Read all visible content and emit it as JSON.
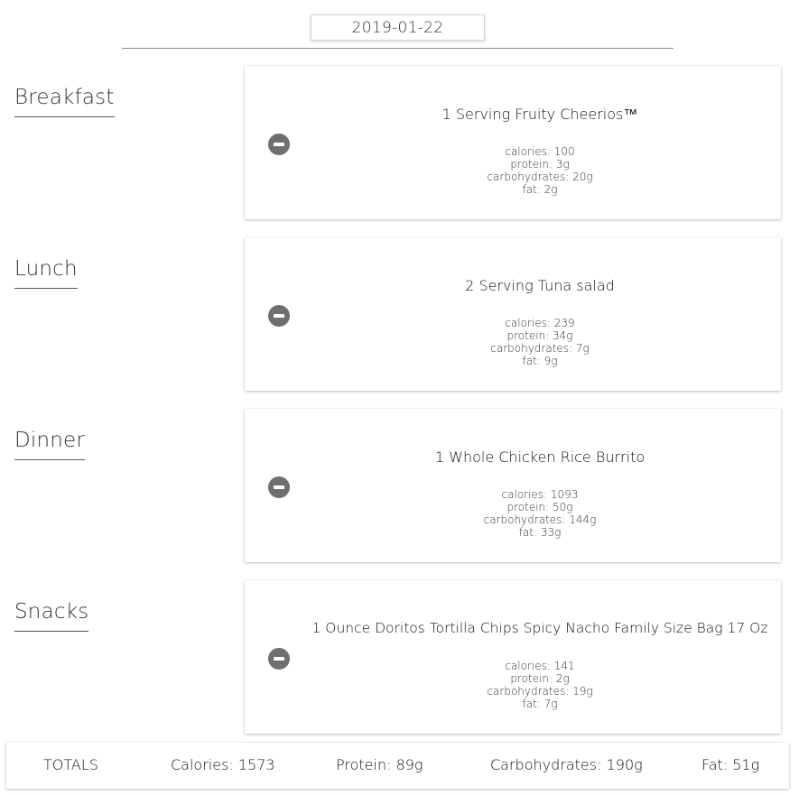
{
  "date": "2019-01-22",
  "meals": [
    {
      "label": "Breakfast",
      "food": "1 Serving Fruity Cheerios™",
      "nutrients": [
        "calories: 100",
        "protein: 3g",
        "carbohydrates: 20g",
        "fat: 2g"
      ]
    },
    {
      "label": "Lunch",
      "food": "2 Serving Tuna salad",
      "nutrients": [
        "calories: 239",
        "protein: 34g",
        "carbohydrates: 7g",
        "fat: 9g"
      ]
    },
    {
      "label": "Dinner",
      "food": "1 Whole Chicken Rice Burrito",
      "nutrients": [
        "calories: 1093",
        "protein: 50g",
        "carbohydrates: 144g",
        "fat: 33g"
      ]
    },
    {
      "label": "Snacks",
      "food": "1 Ounce Doritos Tortilla Chips Spicy Nacho Family Size Bag 17 Oz",
      "nutrients": [
        "calories: 141",
        "protein: 2g",
        "carbohydrates: 19g",
        "fat: 7g"
      ]
    }
  ],
  "totals": {
    "label": "TOTALS",
    "calories": "Calories: 1573",
    "protein": "Protein: 89g",
    "carbohydrates": "Carbohydrates: 190g",
    "fat": "Fat: 51g"
  },
  "icons": {
    "remove": "remove-circle-icon"
  },
  "colors": {
    "remove_icon": "#6f6f6f",
    "rule": "#8a8a8a"
  }
}
